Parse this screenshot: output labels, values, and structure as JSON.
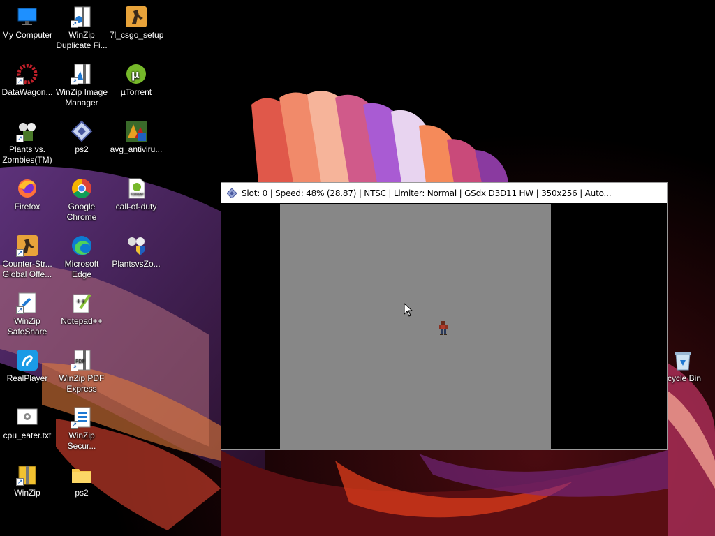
{
  "desktop": {
    "icons": [
      {
        "label": "My Computer",
        "icon": "monitor-icon"
      },
      {
        "label": "WinZip Duplicate Fi...",
        "icon": "winzip-duplicate-icon"
      },
      {
        "label": "7l_csgo_setup",
        "icon": "csgo-icon"
      },
      {
        "label": "DataWagon...",
        "icon": "datawagon-icon"
      },
      {
        "label": "WinZip Image Manager",
        "icon": "winzip-image-icon"
      },
      {
        "label": "µTorrent",
        "icon": "utorrent-icon"
      },
      {
        "label": "Plants vs. Zombies(TM)",
        "icon": "pvz-icon"
      },
      {
        "label": "ps2",
        "icon": "ps2-emulator-icon"
      },
      {
        "label": "avg_antiviru...",
        "icon": "avg-icon"
      },
      {
        "label": "Firefox",
        "icon": "firefox-icon"
      },
      {
        "label": "Google Chrome",
        "icon": "chrome-icon"
      },
      {
        "label": "call-of-duty",
        "icon": "torrent-file-icon"
      },
      {
        "label": "Counter-Str... Global Offe...",
        "icon": "csgo-icon"
      },
      {
        "label": "Microsoft Edge",
        "icon": "edge-icon"
      },
      {
        "label": "PlantsvsZo...",
        "icon": "pvz-icon"
      },
      {
        "label": "WinZip SafeShare",
        "icon": "winzip-safeshare-icon"
      },
      {
        "label": "Notepad++",
        "icon": "notepadpp-icon"
      },
      {
        "label": "RealPlayer",
        "icon": "realplayer-icon"
      },
      {
        "label": "WinZip PDF Express",
        "icon": "winzip-pdf-icon"
      },
      {
        "label": "cpu_eater.txt",
        "icon": "text-file-icon"
      },
      {
        "label": "WinZip Secur...",
        "icon": "winzip-secure-icon"
      },
      {
        "label": "WinZip",
        "icon": "winzip-icon"
      },
      {
        "label": "ps2",
        "icon": "folder-icon"
      },
      {
        "label": "cycle Bin",
        "icon": "recycle-bin-icon"
      }
    ]
  },
  "emulator_window": {
    "title": "Slot: 0 | Speed:  48% (28.87) | NTSC | Limiter: Normal | GSdx D3D11 HW | 350x256 | Auto...",
    "icon": "pcsx2-icon"
  }
}
